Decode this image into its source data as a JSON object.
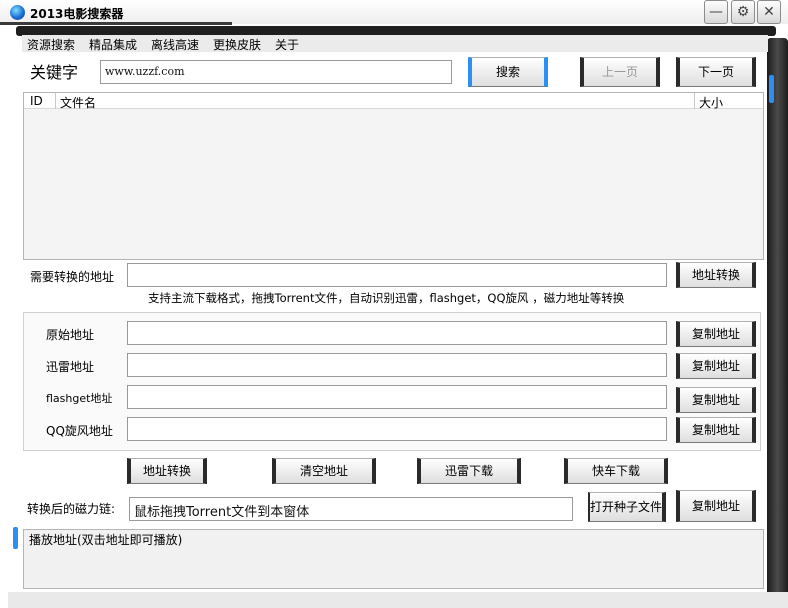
{
  "window": {
    "title": "2013电影搜索器"
  },
  "menu": {
    "items": [
      "资源搜索",
      "精品集成",
      "离线高速",
      "更换皮肤",
      "关于"
    ]
  },
  "search": {
    "label": "关键字",
    "value": "www.uzzf.com",
    "search_button": "搜索",
    "prev_button": "上一页",
    "next_button": "下一页"
  },
  "results": {
    "columns": [
      "ID",
      "文件名",
      "大小"
    ]
  },
  "convert": {
    "label": "需要转换的地址",
    "value": "",
    "button": "地址转换",
    "hint": "支持主流下载格式，拖拽Torrent文件，自动识别迅雷，flashget，QQ旋风 ，磁力地址等转换"
  },
  "addresses": [
    {
      "label": "原始地址",
      "value": "",
      "button": "复制地址"
    },
    {
      "label": "迅雷地址",
      "value": "",
      "button": "复制地址"
    },
    {
      "label": "flashget地址",
      "value": "",
      "button": "复制地址"
    },
    {
      "label": "QQ旋风地址",
      "value": "",
      "button": "复制地址"
    }
  ],
  "actions": {
    "convert": "地址转换",
    "clear": "清空地址",
    "thunder_download": "迅雷下载",
    "express_download": "快车下载"
  },
  "magnet": {
    "label": "转换后的磁力链:",
    "value": "鼠标拖拽Torrent文件到本窗体",
    "open_button": "打开种子文件",
    "copy_button": "复制地址"
  },
  "play": {
    "header": "播放地址(双击地址即可播放)"
  },
  "colors": {
    "accent": "#2d8ff2",
    "frame": "#1f1f1f"
  }
}
